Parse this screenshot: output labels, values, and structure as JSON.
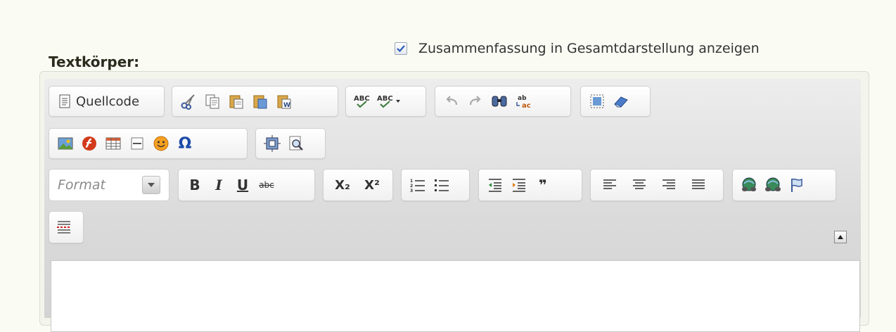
{
  "form": {
    "body_label": "Textkörper:",
    "summary_checkbox": {
      "label": "Zusammenfassung in Gesamtdarstellung anzeigen",
      "checked": true
    }
  },
  "toolbar": {
    "source_label": "Quellcode",
    "format_placeholder": "Format",
    "icons": {
      "source": "source-doc-icon",
      "cut": "cut-icon",
      "copy": "copy-icon",
      "paste": "paste-icon",
      "paste_text": "paste-text-icon",
      "paste_word": "paste-word-icon",
      "spellcheck": "spellcheck-icon",
      "spellcheck_dropdown": "spellcheck-dropdown-icon",
      "undo": "undo-icon",
      "redo": "redo-icon",
      "find": "find-icon",
      "replace": "replace-icon",
      "select_all": "select-all-icon",
      "remove_format": "eraser-icon",
      "image": "image-icon",
      "flash": "flash-icon",
      "table": "table-icon",
      "horizontal_rule": "horizontal-rule-icon",
      "smiley": "smiley-icon",
      "special_char": "omega-icon",
      "iframe": "iframe-icon",
      "preview": "preview-icon",
      "bold": "bold-icon",
      "italic": "italic-icon",
      "underline": "underline-icon",
      "strike": "strikethrough-icon",
      "subscript": "subscript-icon",
      "superscript": "superscript-icon",
      "numbered_list": "numbered-list-icon",
      "bulleted_list": "bulleted-list-icon",
      "outdent": "outdent-icon",
      "indent": "indent-icon",
      "blockquote": "blockquote-icon",
      "align_left": "align-left-icon",
      "align_center": "align-center-icon",
      "align_right": "align-right-icon",
      "justify": "justify-icon",
      "link": "link-icon",
      "unlink": "unlink-icon",
      "anchor": "anchor-flag-icon",
      "page_break": "page-break-icon",
      "collapse": "collapse-toolbar-icon"
    },
    "glyphs": {
      "bold": "B",
      "italic": "I",
      "underline": "U",
      "strike": "abc",
      "subscript": "X₂",
      "superscript": "X²",
      "omega": "Ω",
      "blockquote": "❞"
    }
  },
  "colors": {
    "accent": "#2a6bd6",
    "toolbar_bg": "#dadada",
    "page_bg": "#fafcf4"
  }
}
